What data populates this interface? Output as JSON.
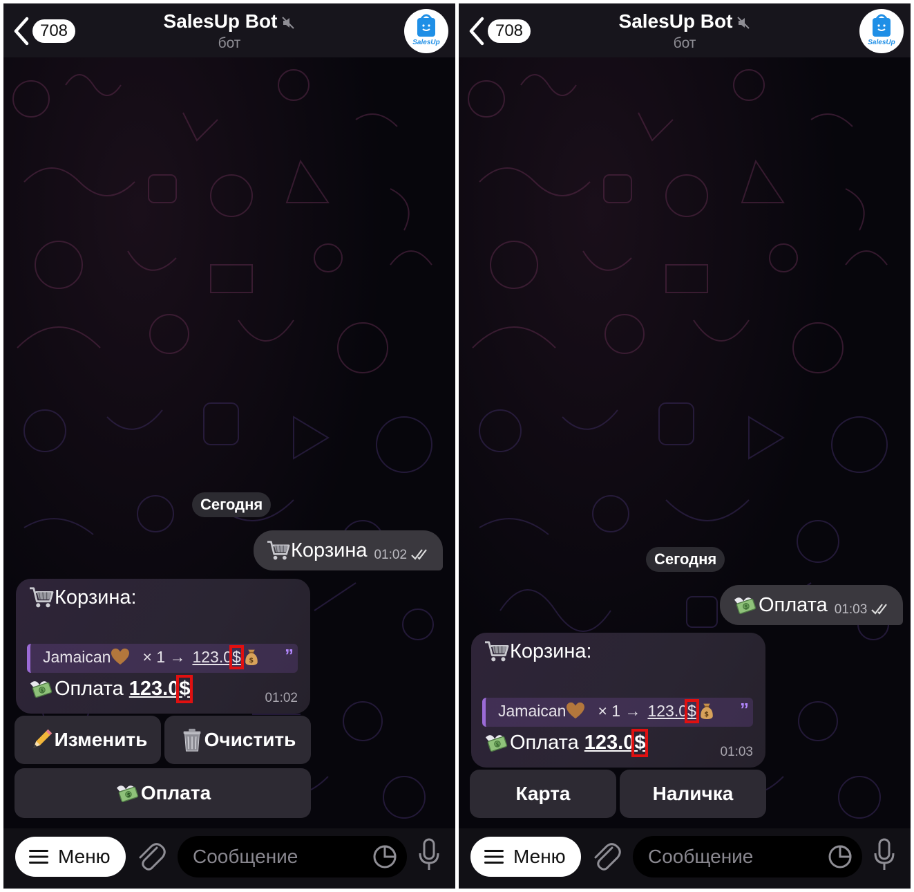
{
  "screens": [
    {
      "header": {
        "back_count": "708",
        "title": "SalesUp Bot",
        "subtitle": "бот",
        "avatar_text": "SalesUp"
      },
      "date_chip": "Сегодня",
      "outgoing": {
        "text": "Корзина",
        "time": "01:02",
        "emoji": "cart-icon"
      },
      "incoming": {
        "title": "Корзина:",
        "quote": {
          "product": "Jamaican",
          "qty": "×  1 →",
          "price": "123.0",
          "currency": "$"
        },
        "pay_label": "Оплата",
        "pay_amount": "123.0",
        "pay_currency": "$",
        "time": "01:02"
      },
      "keyboard": [
        [
          {
            "label": "Изменить",
            "icon": "pencil-icon"
          },
          {
            "label": "Очистить",
            "icon": "trash-icon"
          }
        ],
        [
          {
            "label": "Оплата",
            "icon": "money-wings-icon"
          }
        ]
      ],
      "input": {
        "menu_label": "Меню",
        "placeholder": "Сообщение"
      }
    },
    {
      "header": {
        "back_count": "708",
        "title": "SalesUp Bot",
        "subtitle": "бот",
        "avatar_text": "SalesUp"
      },
      "date_chip": "Сегодня",
      "outgoing": {
        "text": "Оплата",
        "time": "01:03",
        "emoji": "money-wings-icon"
      },
      "incoming": {
        "title": "Корзина:",
        "quote": {
          "product": "Jamaican",
          "qty": "×  1 →",
          "price": "123.0",
          "currency": "$"
        },
        "pay_label": "Оплата",
        "pay_amount": "123.0",
        "pay_currency": "$",
        "time": "01:03"
      },
      "keyboard": [
        [
          {
            "label": "Карта"
          },
          {
            "label": "Наличка"
          }
        ]
      ],
      "input": {
        "menu_label": "Меню",
        "placeholder": "Сообщение"
      }
    }
  ],
  "colors": {
    "highlight": "#e01010",
    "quote_bar": "#9b6bd6",
    "bubble_out": "#3a383e",
    "accent": "#b388ff"
  }
}
